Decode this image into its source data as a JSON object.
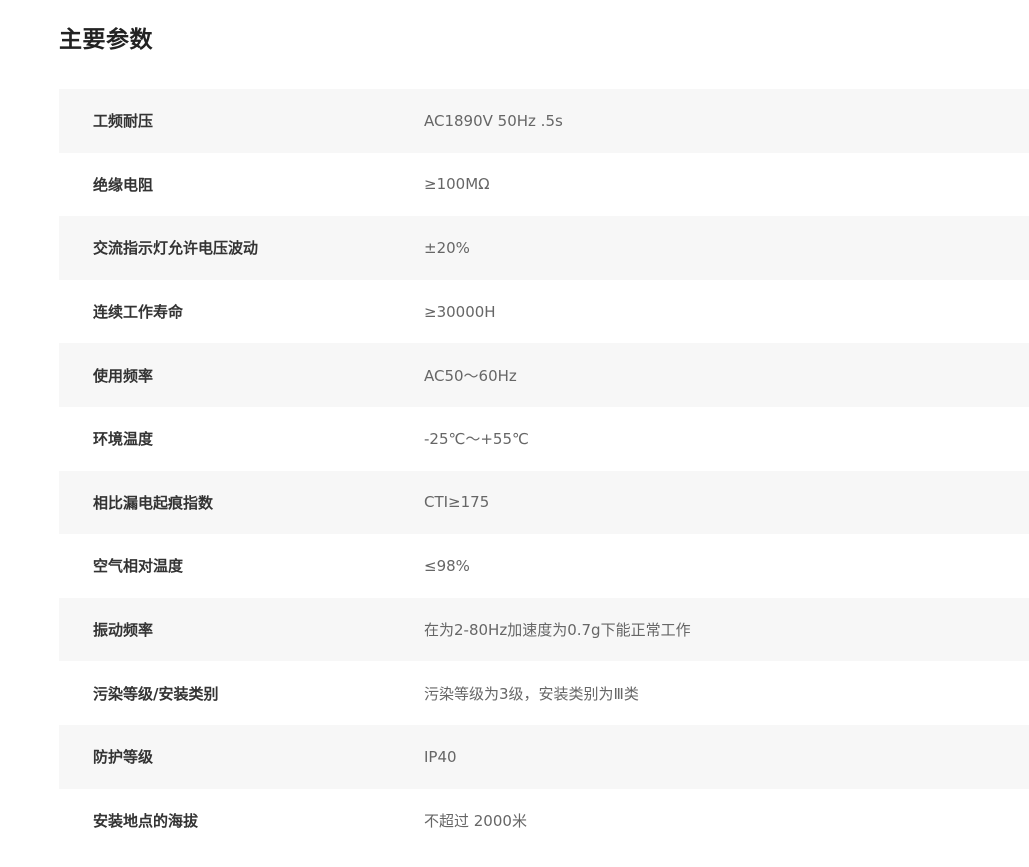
{
  "page": {
    "title": "主要参数"
  },
  "specs": [
    {
      "label": "工频耐压",
      "value": "AC1890V 50Hz .5s"
    },
    {
      "label": "绝缘电阻",
      "value": "≥100MΩ"
    },
    {
      "label": "交流指示灯允许电压波动",
      "value": "±20%"
    },
    {
      "label": "连续工作寿命",
      "value": "≥30000H"
    },
    {
      "label": "使用频率",
      "value": "AC50～60Hz"
    },
    {
      "label": "环境温度",
      "value": "-25℃～+55℃"
    },
    {
      "label": "相比漏电起痕指数",
      "value": "CTI≥175"
    },
    {
      "label": "空气相对温度",
      "value": "≤98%"
    },
    {
      "label": "振动频率",
      "value": "在为2-80Hz加速度为0.7g下能正常工作"
    },
    {
      "label": "污染等级/安装类别",
      "value": "污染等级为3级，安装类别为Ⅲ类"
    },
    {
      "label": "防护等级",
      "value": "IP40"
    },
    {
      "label": "安装地点的海拔",
      "value": "不超过 2000米"
    }
  ]
}
